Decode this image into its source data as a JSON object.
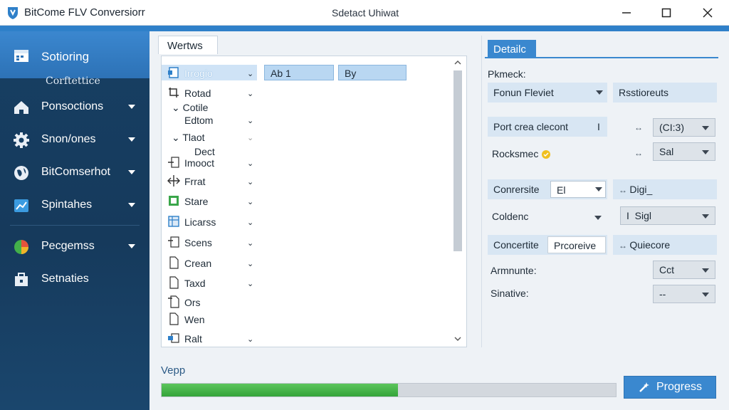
{
  "window": {
    "title": "BitCome FLV Conversiorr",
    "subtitle": "Sdetact Uhiwat",
    "controls": [
      "minimize",
      "maximize",
      "close"
    ]
  },
  "sidebar": {
    "active": {
      "label": "Sotioring",
      "sub_label": "Corftettice",
      "icon": "calendar-icon"
    },
    "items": [
      {
        "label": "Ponsoctions",
        "icon": "home-icon"
      },
      {
        "label": "Snon/ones",
        "icon": "gear-icon"
      },
      {
        "label": "BitComserhot",
        "icon": "globe-icon"
      },
      {
        "label": "Spintahes",
        "icon": "chart-icon"
      },
      {
        "label": "Pecgemss",
        "icon": "pie-icon"
      },
      {
        "label": "Setnaties",
        "icon": "toolbox-icon"
      }
    ]
  },
  "main": {
    "tab_label": "Wertws",
    "tree": {
      "columns": [
        "Ab 1",
        "By"
      ],
      "rows": [
        {
          "label": "Irrogio",
          "selected": true
        },
        {
          "label": "Rotad"
        },
        {
          "label": "Cotile"
        },
        {
          "label": "Edtom"
        },
        {
          "label": "Tlaot"
        },
        {
          "label": "Dect"
        },
        {
          "label": "Imooct"
        },
        {
          "label": "Frrat"
        },
        {
          "label": "Stare"
        },
        {
          "label": "Licarss"
        },
        {
          "label": "Scens"
        },
        {
          "label": "Crean"
        },
        {
          "label": "Taxd"
        },
        {
          "label": "Ors"
        },
        {
          "label": "Wen"
        },
        {
          "label": "Ralt"
        }
      ]
    }
  },
  "details": {
    "tab_label": "Detailc",
    "header": "Pkmeck:",
    "field_1": "Fonun Fleviet",
    "field_2": "Rsstioreuts",
    "row_1_label": "Port crea clecont",
    "row_1_marker": "I",
    "row_1_select": "(CI:3)",
    "row_2_label": "Rocksmec",
    "row_2_select": "Sal",
    "row_3_label": "Conrersite",
    "row_3_input": "El",
    "row_3_right": "Digi_",
    "row_4_label": "Coldenc",
    "row_4_select": "Sigl",
    "row_4_select_prefix": "I",
    "row_5_label": "Concertite",
    "row_5_input": "Prcoreive",
    "row_5_right": "Quiecore",
    "row_6_label": "Armnunte:",
    "row_6_select": "Cct",
    "row_7_label": "Sinative:",
    "row_7_select": "--"
  },
  "footer": {
    "status": "Vepp",
    "progress": 0.52,
    "button_label": "Progress"
  },
  "colors": {
    "accent": "#2f80c9",
    "sidebar_bg": "#173f63",
    "progress_fill": "#3fae45"
  }
}
